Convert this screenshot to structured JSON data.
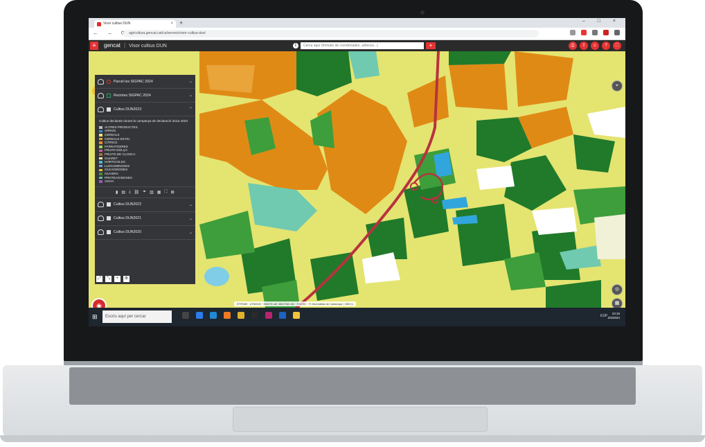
{
  "browser": {
    "tab_title": "Visor cultius DUN",
    "url": "agricultura.gencat.cat/ca/serveis/visor-cultius-dun/"
  },
  "app": {
    "brand": "gencat",
    "title": "Visor cultius DUN",
    "search_placeholder": "Cerca aquí (formats de coordenades, adreces...)"
  },
  "layers": [
    {
      "label": "Parcel·les SIGPAC 2024",
      "expanded": false,
      "symbol_color": "#e23a3a"
    },
    {
      "label": "Recintes SIGPAC 2024",
      "expanded": false,
      "symbol_color": "#2fa36b"
    },
    {
      "label": "Cultius DUN2023",
      "expanded": true,
      "symbol_color": "#dddddd"
    },
    {
      "label": "Cultius DUN2022",
      "expanded": false,
      "symbol_color": "#dddddd"
    },
    {
      "label": "Cultius DUN2021",
      "expanded": false,
      "symbol_color": "#dddddd"
    },
    {
      "label": "Cultius DUN2020",
      "expanded": false,
      "symbol_color": "#dddddd"
    }
  ],
  "expanded_layer": {
    "description": "Cultius declarats durant la campanya de declaració única 2023",
    "legend": [
      {
        "label": "ALTRES PRODUCTES",
        "color": "#b8b8b8"
      },
      {
        "label": "ARROS",
        "color": "#3b8fd6"
      },
      {
        "label": "CEREALS",
        "color": "#f0e27a"
      },
      {
        "label": "CEREALS ESTIU",
        "color": "#e7a437"
      },
      {
        "label": "CITRICS",
        "color": "#f08a2b"
      },
      {
        "label": "FARRATGERES",
        "color": "#9bcf5b"
      },
      {
        "label": "FRUITA DOLÇA",
        "color": "#d65c9e"
      },
      {
        "label": "FRUITS DE CLOSCA",
        "color": "#a86b3c"
      },
      {
        "label": "GUARET",
        "color": "#f2f0a8"
      },
      {
        "label": "HORTICOLES",
        "color": "#49b6d6"
      },
      {
        "label": "LLEGUMINOSES",
        "color": "#7aa3d9"
      },
      {
        "label": "OLEAGINOSES",
        "color": "#e6c52b"
      },
      {
        "label": "OLIVERA",
        "color": "#4d8a3c"
      },
      {
        "label": "PROTEAGINOSES",
        "color": "#5fc2a6"
      },
      {
        "label": "VINYA",
        "color": "#9b59b6"
      }
    ]
  },
  "map": {
    "scale_text": "ETRS89 · UTM31N · 305276 mE 4602768 mN · © ICGC · © Generalitat de Catalunya",
    "scale_bar": "500 m"
  },
  "taskbar": {
    "search_placeholder": "Escriu aquí per cercar",
    "tray": "ESP",
    "time": "10:16",
    "date": "2/4/2024"
  },
  "colors": {
    "orange": "#e08a16",
    "yellow": "#e4e471",
    "dark_green": "#207a2a",
    "green": "#3e9e3b",
    "teal": "#6fcab0",
    "blue": "#31a6dd",
    "road": "#b7333e",
    "white": "#ffffff"
  }
}
